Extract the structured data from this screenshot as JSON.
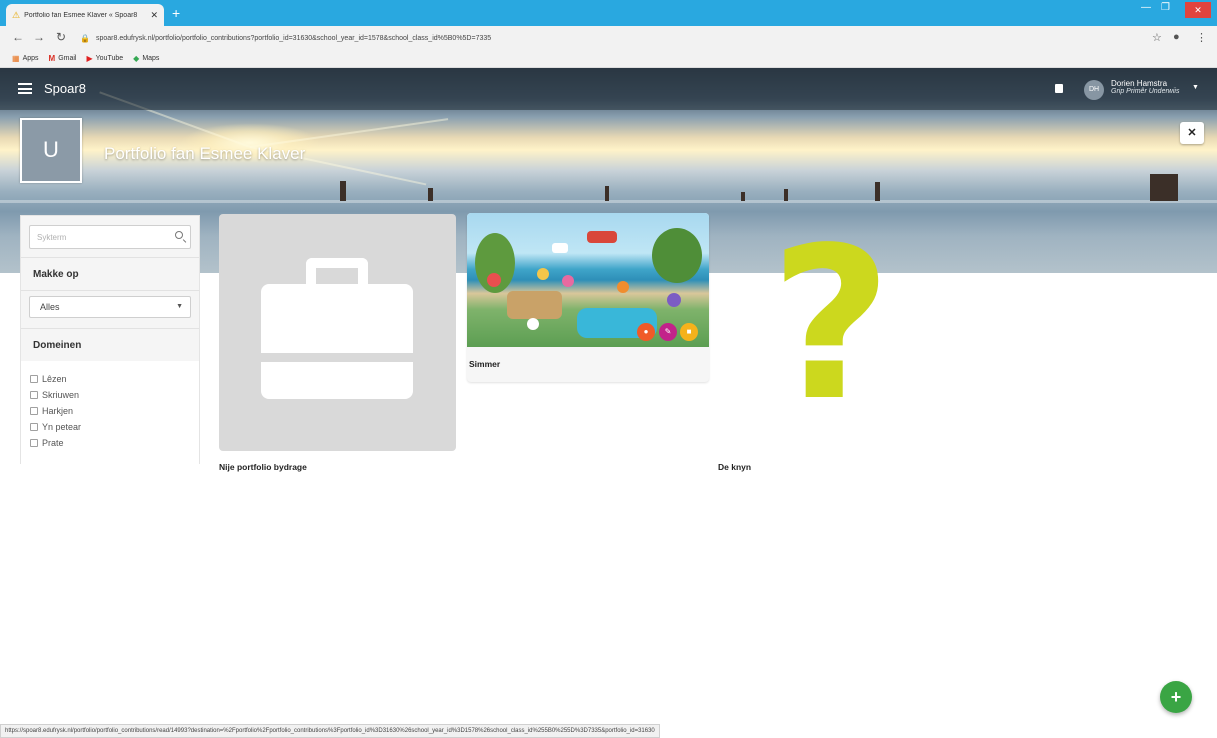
{
  "browser": {
    "tab_title": "Portfolio fan Esmee Klaver « Spoar8",
    "tab_close": "✕",
    "new_tab": "+",
    "url": "spoar8.edufrysk.nl/portfolio/portfolio_contributions?portfolio_id=31630&school_year_id=1578&school_class_id%5B0%5D=7335",
    "bookmarks": [
      "Apps",
      "Gmail",
      "YouTube",
      "Maps"
    ],
    "status_url": "https://spoar8.edufrysk.nl/portfolio/portfolio_contributions/read/14993?destination=%2Fportfolio%2Fportfolio_contributions%3Fportfolio_id%3D31630%26school_year_id%3D1578%26school_class_id%255B0%255D%3D7335&portfolio_id=31630"
  },
  "app": {
    "brand": "Spoar8",
    "user": {
      "initials": "DH",
      "name": "Dorien Hamstra",
      "org": "Grip Primêr Underwiis"
    },
    "profile_initial": "U",
    "page_title": "Portfolio fan Esmee Klaver",
    "close_label": "✕"
  },
  "sidebar": {
    "search_placeholder": "Sykterm",
    "makke_op_title": "Makke op",
    "select_value": "Alles",
    "domeinen_title": "Domeinen",
    "domains": [
      "Lêzen",
      "Skriuwen",
      "Harkjen",
      "Yn petear",
      "Prate"
    ]
  },
  "cards": {
    "new_label": "Nije portfolio bydrage",
    "simmer_label": "Simmer",
    "knyn_label": "De knyn",
    "qmark": "?"
  },
  "fab_label": "+",
  "colors": {
    "tabbar": "#29a8e0",
    "accent_green": "#3aa544",
    "qmark": "#ccd81e",
    "action_orange": "#f05a28",
    "action_magenta": "#c2238a",
    "action_yellow": "#f5b21b"
  }
}
